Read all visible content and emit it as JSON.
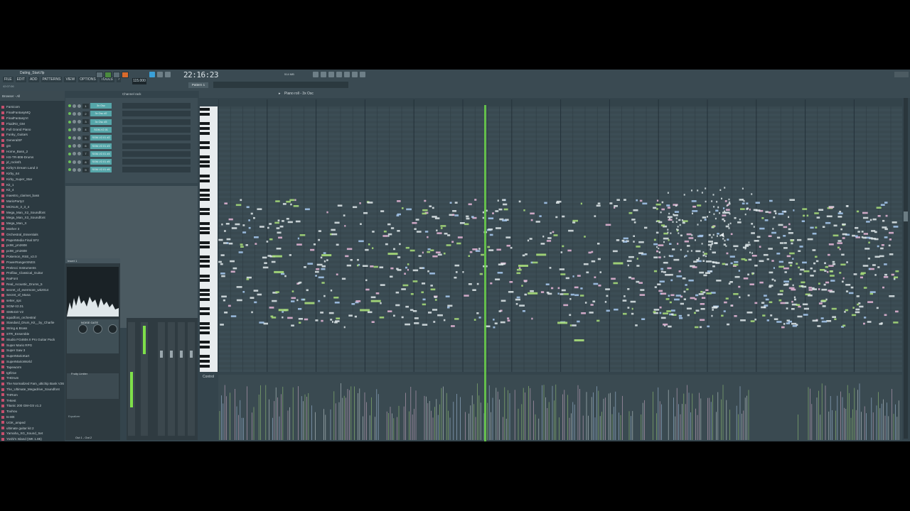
{
  "window": {
    "title": "Dating_Start.flp",
    "hint": "42:07:06"
  },
  "menu": [
    "FILE",
    "EDIT",
    "ADD",
    "PATTERNS",
    "VIEW",
    "OPTIONS",
    "TOOLS",
    "?"
  ],
  "transport": {
    "tempo": "115.000",
    "clock": "22:16:23",
    "pattern": "Pattern 1",
    "cpu": "514 MB"
  },
  "browser": {
    "label": "Browser - All",
    "items": [
      "Famicom",
      "FinalFantasyMQ",
      "FinalFantasyVI",
      "FluidR3_GM",
      "Full Grand Piano",
      "Funky_Guitars",
      "GeneralSF",
      "gm",
      "Home_Bass_2",
      "HS-TR-808-Drums",
      "jd_rocksf1",
      "Kirby's Dream Land 3",
      "Kirby_64",
      "Kirby_Super_Star",
      "Kit_1",
      "Kit_4",
      "maestro_clarinet_bass",
      "MarioParty2",
      "MCNUS_3_3_4",
      "Mega_Man_X2_Soundfont",
      "Mega_Man_X3_Soundfont",
      "Mega_Man_X",
      "Mother 3",
      "Orchestral_Essentials",
      "PaperMedia Final SF2",
      "pc98_ym2608",
      "pc98_ym2608",
      "Pokemon_RSE_v2.0",
      "PowerRangerSNES",
      "Prelecci Instruments",
      "Profilax_Classical_Guitar",
      "RaiFont",
      "Real_Acoustic_Drums_5",
      "secret_of_evermore_wk2014",
      "Secret_of_Mana",
      "setter_spc",
      "SGM-V2.01",
      "SM6410 V2",
      "squidfont_orchestral",
      "Standard_Drum_Kit__by_Charlie",
      "String & Brass",
      "STR_Ensemble",
      "Studio FG460s II Pro Guitar Pack",
      "Super Mario RPG",
      "Super Saw 3",
      "SuperMarioKart",
      "SuperMarioWorld",
      "Tapeworm",
      "tgtf21e",
      "THDrum",
      "The Normalized Fam_ultichip Bank V26",
      "The_Ultimate_Megadrive_Soundfont",
      "THRom",
      "THtest",
      "Titanic 200 GM-GS v1.2",
      "Touhou",
      "ts-80t",
      "UGK_amped",
      "ultimate guitar kit 2",
      "Yamaha_XG_Sound_Set",
      "Yoshi's Island (WK 1.85)"
    ]
  },
  "channel_rack": {
    "title": "Channel rack",
    "channels": [
      {
        "num": "1",
        "name": "3x Osc"
      },
      {
        "num": "2",
        "name": "3x Osc #2"
      },
      {
        "num": "3",
        "name": "3x Osc #3"
      },
      {
        "num": "4",
        "name": "SGM-V2.01"
      },
      {
        "num": "5",
        "name": "SGM-V2.01 #2"
      },
      {
        "num": "6",
        "name": "SGM-V2.01 #3"
      },
      {
        "num": "7",
        "name": "SGM-V2.01 #4"
      },
      {
        "num": "8",
        "name": "SGM-V2.01 #5"
      },
      {
        "num": "9",
        "name": "SGM-V2.01 #6"
      }
    ]
  },
  "plugin": {
    "title": "Insert 1",
    "gate_label": "NOISE GATE",
    "limiter_label": "Fruity Limiter",
    "eq_label": "Equalizer",
    "out_label": "Out 1 - Out 2"
  },
  "piano_roll": {
    "title": "Piano roll - 3x Osc",
    "control_label": "Control",
    "colors": {
      "note_white": "#dfe8ea",
      "note_blue": "#a7c9f0",
      "note_pink": "#e8b7d8",
      "note_green": "#a9de7a",
      "playhead": "#6bd24a"
    }
  }
}
